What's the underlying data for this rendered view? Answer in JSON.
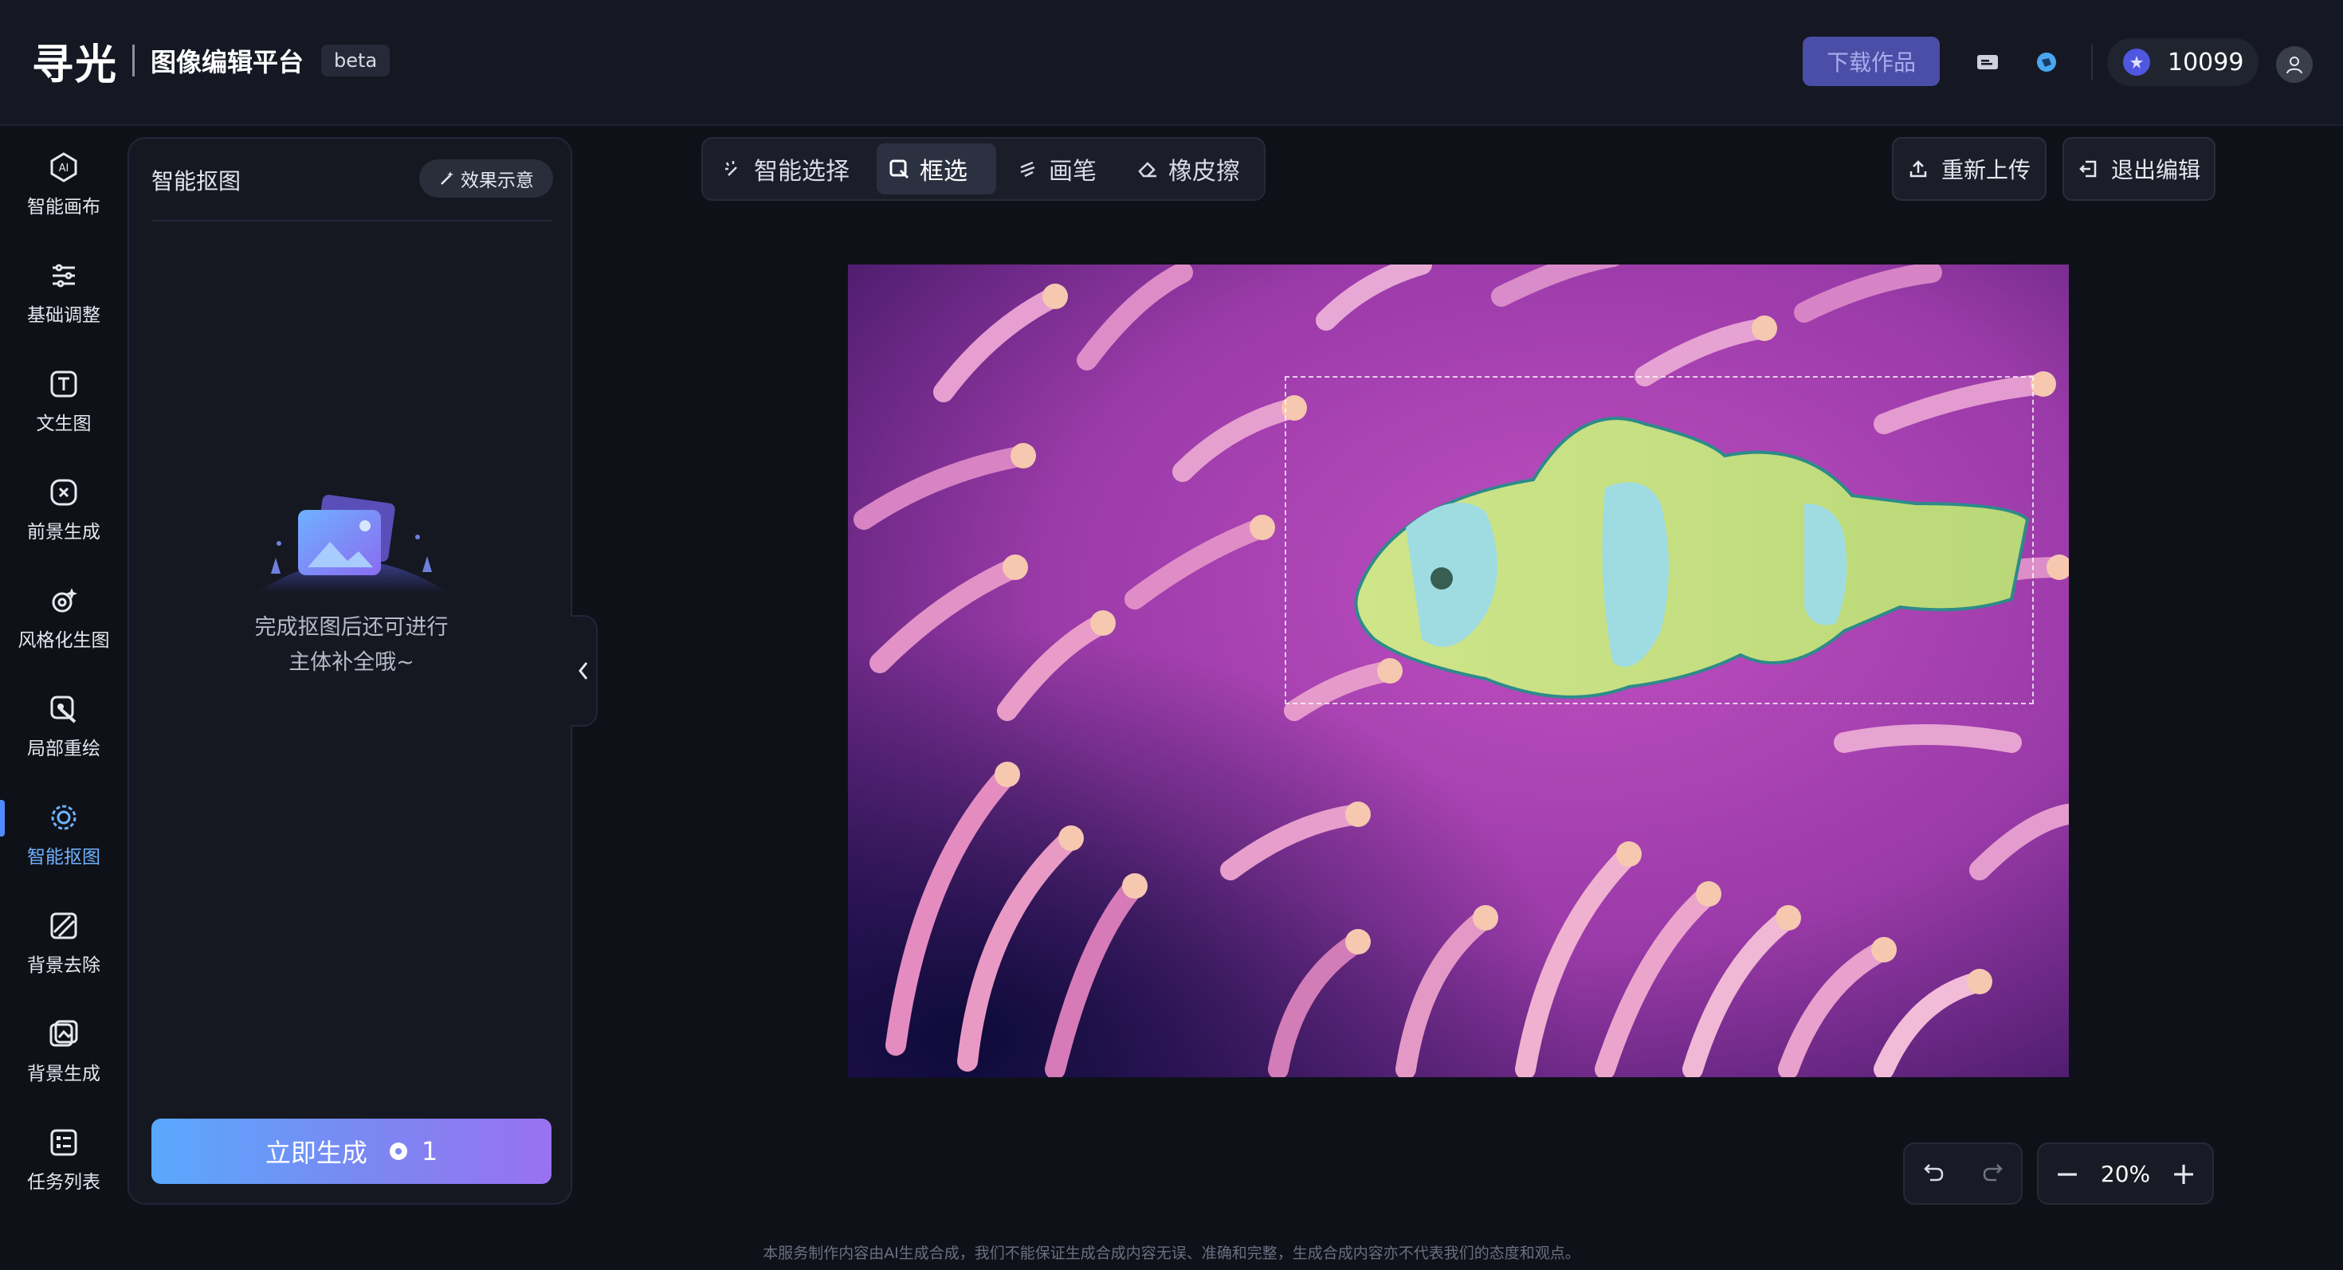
{
  "app": {
    "logo_text": "寻光",
    "platform_name": "图像编辑平台",
    "beta_label": "beta"
  },
  "header": {
    "download_label": "下载作品",
    "credits": "10099",
    "icons": [
      "message-icon",
      "sphere-icon",
      "coin-icon",
      "user-avatar-icon"
    ]
  },
  "nav": {
    "items": [
      {
        "label": "智能画布",
        "icon": "ai-canvas-icon"
      },
      {
        "label": "基础调整",
        "icon": "sliders-icon"
      },
      {
        "label": "文生图",
        "icon": "text-image-icon"
      },
      {
        "label": "前景生成",
        "icon": "foreground-icon"
      },
      {
        "label": "风格化生图",
        "icon": "style-icon"
      },
      {
        "label": "局部重绘",
        "icon": "inpaint-icon"
      },
      {
        "label": "智能抠图",
        "icon": "cutout-icon",
        "active": true
      },
      {
        "label": "背景去除",
        "icon": "bg-remove-icon"
      },
      {
        "label": "背景生成",
        "icon": "bg-generate-icon"
      },
      {
        "label": "任务列表",
        "icon": "task-list-icon"
      }
    ]
  },
  "panel": {
    "title": "智能抠图",
    "effect_label": "效果示意",
    "empty_line1": "完成抠图后还可进行",
    "empty_line2": "主体补全哦~",
    "generate_label": "立即生成",
    "generate_cost": "1"
  },
  "toolbar": {
    "tools": [
      {
        "label": "智能选择",
        "icon": "magic-wand-icon"
      },
      {
        "label": "框选",
        "icon": "box-select-icon",
        "active": true
      },
      {
        "label": "画笔",
        "icon": "brush-icon"
      },
      {
        "label": "橡皮擦",
        "icon": "eraser-icon"
      }
    ],
    "reupload_label": "重新上传",
    "exit_label": "退出编辑"
  },
  "canvas": {
    "zoom": "20%"
  },
  "footer": {
    "disclaimer": "本服务制作内容由AI生成合成，我们不能保证生成合成内容无误、准确和完整，生成合成内容亦不代表我们的态度和观点。"
  },
  "colors": {
    "accent": "#4f8cff",
    "active_nav_text": "#6fb3ff",
    "download_bg": "#4a4ea6",
    "generate_gradient_start": "#59a9ff",
    "generate_gradient_end": "#9a71f1"
  }
}
